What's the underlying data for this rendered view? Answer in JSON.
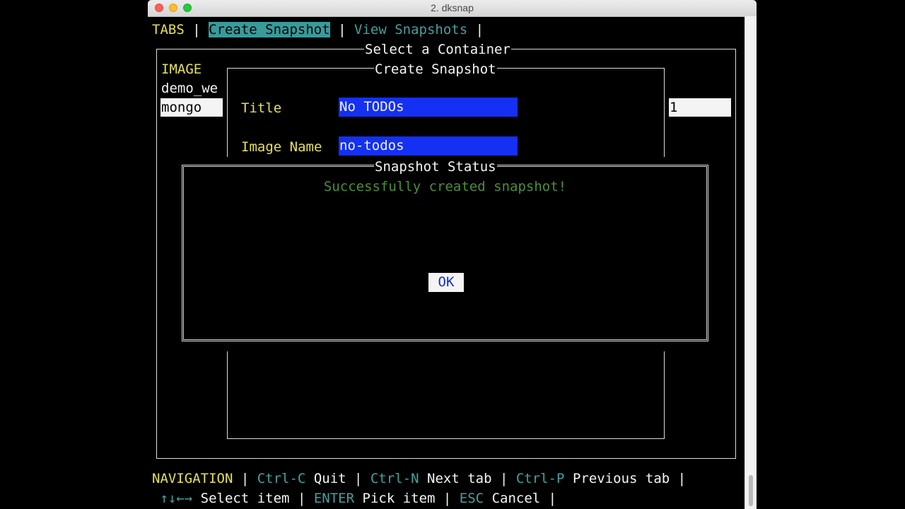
{
  "window": {
    "title": "2. dksnap"
  },
  "tabs": {
    "label": "TABS",
    "items": [
      {
        "label": "Create Snapshot"
      },
      {
        "label": "View Snapshots"
      }
    ]
  },
  "container_panel": {
    "title": "Select a Container",
    "column_header": "IMAGE",
    "rows": [
      "demo_we",
      "mongo"
    ],
    "selected_row": "mongo",
    "right_value": "1"
  },
  "create_snapshot": {
    "title": "Create Snapshot",
    "fields": [
      {
        "label": "Title",
        "value": "No TODOs"
      },
      {
        "label": "Image Name",
        "value": "no-todos"
      }
    ]
  },
  "status_dialog": {
    "title": "Snapshot Status",
    "message": "Successfully created snapshot!",
    "ok_label": "OK"
  },
  "navigation": {
    "label": "NAVIGATION",
    "line1": [
      {
        "key": "Ctrl-C",
        "action": "Quit"
      },
      {
        "key": "Ctrl-N",
        "action": "Next tab"
      },
      {
        "key": "Ctrl-P",
        "action": "Previous tab"
      }
    ],
    "line2": [
      {
        "key": "↑↓←→",
        "action": "Select item"
      },
      {
        "key": "ENTER",
        "action": "Pick item"
      },
      {
        "key": "ESC",
        "action": "Cancel"
      }
    ]
  },
  "colors": {
    "accent_teal": "#3a9a9a",
    "field_blue": "#1430f2",
    "label_yellow": "#e5e05a",
    "success_green": "#4c8f3b"
  }
}
